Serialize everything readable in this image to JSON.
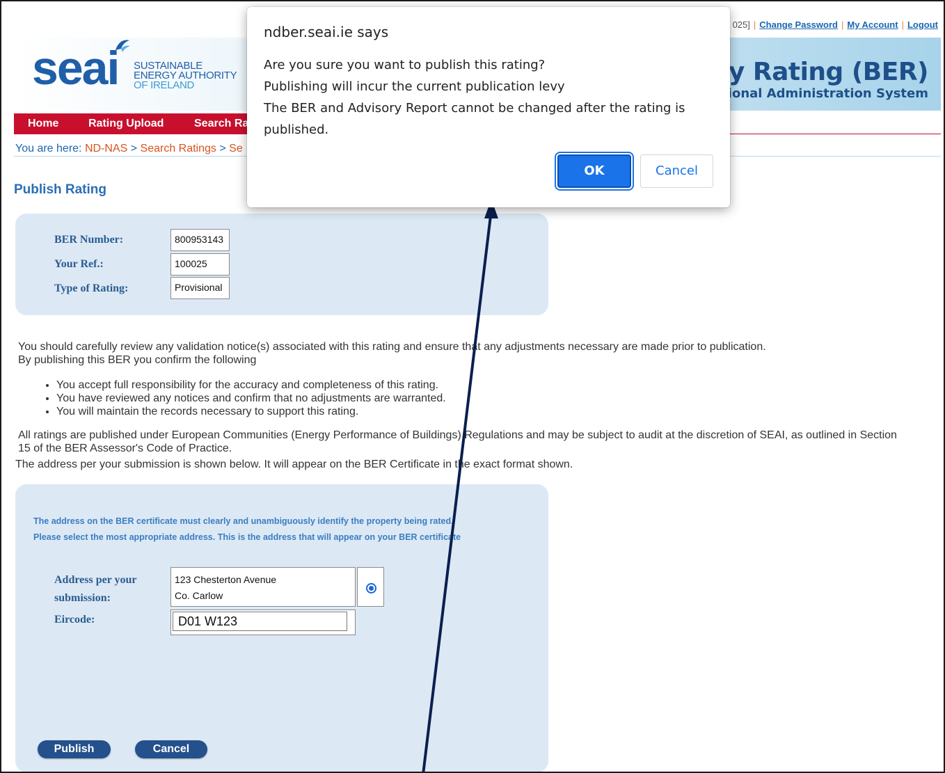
{
  "header": {
    "logo_word": "seai",
    "logo_sub_1": "SUSTAINABLE",
    "logo_sub_2": "ENERGY AUTHORITY",
    "logo_sub_3": "OF IRELAND",
    "title_main": "ergy Rating (BER)",
    "title_sub": "National Administration System",
    "user_fragment": "025]",
    "links": [
      "Change Password",
      "My Account",
      "Logout"
    ]
  },
  "nav": {
    "items": [
      "Home",
      "Rating Upload",
      "Search Ra"
    ]
  },
  "breadcrumb": {
    "prefix": "You are here: ",
    "item1": "ND-NAS",
    "sep": " > ",
    "item2": "Search Ratings",
    "item3": "Se"
  },
  "page_title": "Publish Rating",
  "rating_info": {
    "ber_label": "BER Number:",
    "ber_value": "800953143",
    "ref_label": "Your Ref.:",
    "ref_value": "100025",
    "type_label": "Type of Rating:",
    "type_value": "Provisional"
  },
  "body_text": {
    "p1": "You should carefully review any validation notice(s) associated with this rating and ensure that any adjustments necessary are made prior to publication.",
    "p2": "By publishing this BER you confirm the following",
    "bullets": [
      "You accept full responsibility for the accuracy and completeness of this rating.",
      "You have reviewed any notices and confirm that no adjustments are warranted.",
      "You will maintain the records necessary to support this rating."
    ],
    "p3a": "All ratings are published under European Communities (Energy Performance of Buildings) Regulations and may be subject to audit at the discretion of SEAI, as outlined in Section",
    "p3b": "15 of the BER Assessor's Code of Practice.",
    "p4": "The address per your submission is shown below. It will appear on the BER Certificate in the exact format shown."
  },
  "address_panel": {
    "notice1": "The address on the BER certificate must clearly and unambiguously identify the property being rated.",
    "notice2": "Please select the most appropriate address. This is the address that will appear on your BER certificate",
    "address_label_1": "Address per your",
    "address_label_2": "submission:",
    "address_line1": "123 Chesterton Avenue",
    "address_line2": "Co. Carlow",
    "eircode_label": "Eircode:",
    "eircode_value": "D01 W123",
    "publish_button": "Publish",
    "cancel_button": "Cancel"
  },
  "dialog": {
    "title": "ndber.seai.ie says",
    "line1": "Are you sure you want to publish this rating?",
    "line2": "Publishing will incur the current publication levy",
    "line3": "The BER and Advisory Report cannot be changed after the rating is published.",
    "ok": "OK",
    "cancel": "Cancel"
  },
  "colors": {
    "nav_red": "#c8102e",
    "brand_blue": "#1f5ea8",
    "panel_bg": "#dce9f5",
    "dialog_blue": "#1a73e8",
    "arrow": "#0b1f4f"
  }
}
